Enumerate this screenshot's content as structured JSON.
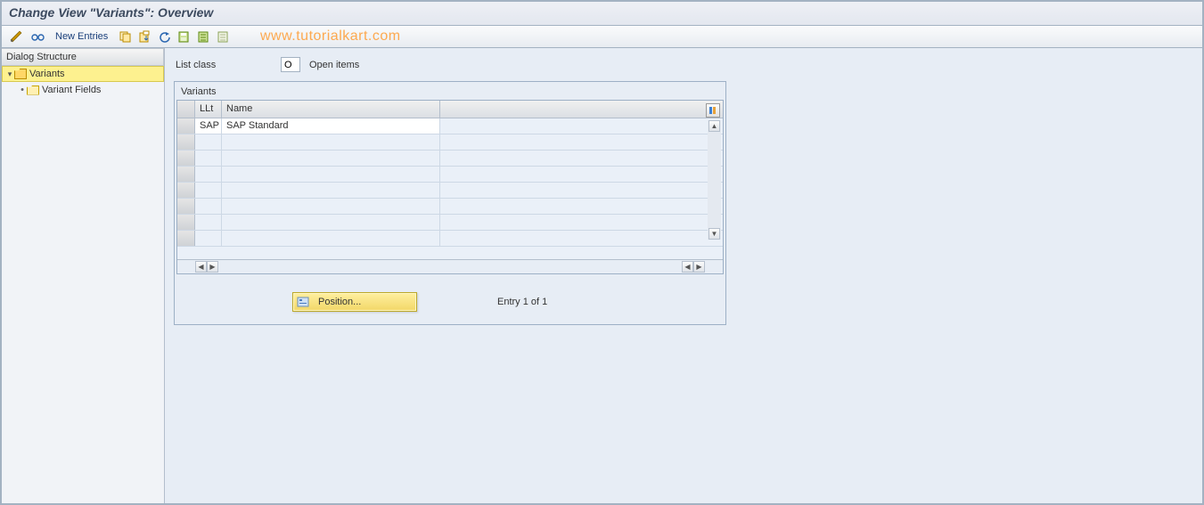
{
  "title": "Change View \"Variants\": Overview",
  "toolbar": {
    "new_entries_label": "New Entries",
    "icons": [
      "pencil-check-icon",
      "glasses-icon",
      "copy-icon",
      "paste-icon",
      "undo-icon",
      "save-icon",
      "select-all-icon",
      "deselect-all-icon"
    ]
  },
  "watermark": "www.tutorialkart.com",
  "dialog_structure": {
    "header": "Dialog Structure",
    "nodes": [
      {
        "label": "Variants",
        "selected": true,
        "icon": "folder-open",
        "level": 0
      },
      {
        "label": "Variant Fields",
        "selected": false,
        "icon": "folder-closed",
        "level": 1
      }
    ]
  },
  "list_class": {
    "label": "List class",
    "value": "O",
    "description": "Open items"
  },
  "variants_box": {
    "title": "Variants",
    "columns": {
      "llt": "LLt",
      "name": "Name"
    },
    "rows": [
      {
        "llt": "SAP",
        "name": "SAP Standard"
      }
    ],
    "empty_rows": 7
  },
  "footer": {
    "position_label": "Position...",
    "entry_text": "Entry 1 of 1"
  }
}
